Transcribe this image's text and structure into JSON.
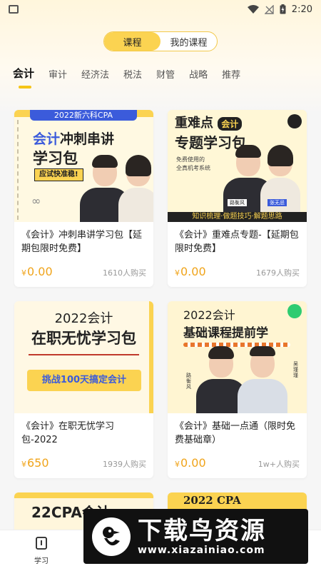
{
  "status": {
    "time": "2:20"
  },
  "segment": {
    "courses": "课程",
    "my_courses": "我的课程",
    "active": "courses"
  },
  "tabs": [
    "会计",
    "审计",
    "经济法",
    "税法",
    "财管",
    "战略",
    "推荐"
  ],
  "cards": [
    {
      "title": "《会计》冲刺串讲学习包【延期包限时免费】",
      "price_symbol": "¥",
      "price": "0.00",
      "buyers": "1610人购买",
      "thumb": {
        "top_line": "2022新六科CPA",
        "heading_a": "会计",
        "heading_b": "冲刺串讲",
        "heading_c": "学习包",
        "tag": "应试快准稳!"
      }
    },
    {
      "title": "《会计》重难点专题-【延期包限时免费】",
      "price_symbol": "¥",
      "price": "0.00",
      "buyers": "1679人购买",
      "thumb": {
        "heading_a": "重难点",
        "badge": "会计",
        "heading_b": "专题学习包",
        "sub1": "免费使用的",
        "sub2": "全真机考系统",
        "name1": "路衡风",
        "name2": "张无忌",
        "footer": "知识梳理·做题技巧·解题思路"
      }
    },
    {
      "title": "《会计》在职无忧学习包-2022",
      "price_symbol": "¥",
      "price": "650",
      "buyers": "1939人购买",
      "thumb": {
        "line1": "2022会计",
        "line2": "在职无忧学习包",
        "banner": "挑战100天搞定会计"
      }
    },
    {
      "title": "《会计》基础一点通（限时免费基础章）",
      "price_symbol": "¥",
      "price": "0.00",
      "buyers": "1w+人购买",
      "thumb": {
        "line1": "2022会计",
        "line2": "基础课程提前学",
        "name1": "路衡风",
        "name2": "吴瑾瑾"
      }
    }
  ],
  "partial_cards": [
    {
      "text": "22CPA会计"
    },
    {
      "text": "2022 CPA"
    }
  ],
  "bottom_nav": {
    "study_label": "学习"
  },
  "watermark": {
    "title": "下载鸟资源",
    "url": "www.xiazainiao.com"
  },
  "colors": {
    "accent": "#fbd351",
    "price": "#f0a41b",
    "indicator": "#f5c518"
  }
}
